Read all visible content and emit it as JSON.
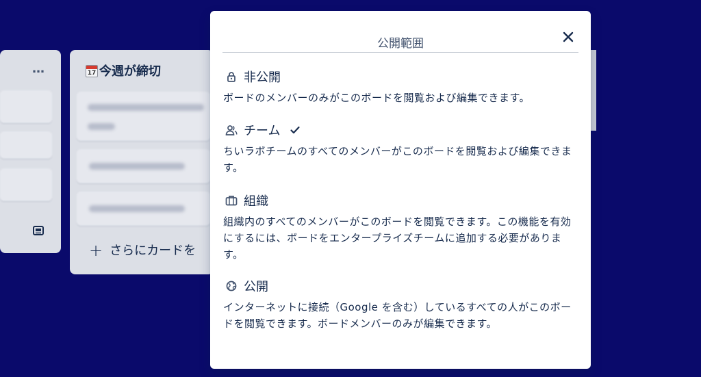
{
  "board": {
    "more_label": "…",
    "list_title": "今週が締切",
    "calendar_day": "17",
    "add_card_label": "さらにカードを"
  },
  "popover": {
    "title": "公開範囲",
    "close_label": "Close",
    "options": [
      {
        "name": "非公開",
        "icon": "lock-icon",
        "selected": false,
        "description": "ボードのメンバーのみがこのボードを閲覧および編集できます。"
      },
      {
        "name": "チーム",
        "icon": "team-icon",
        "selected": true,
        "description": "ちいラボチームのすべてのメンバーがこのボードを閲覧および編集できます。"
      },
      {
        "name": "組織",
        "icon": "briefcase-icon",
        "selected": false,
        "description": "組織内のすべてのメンバーがこのボードを閲覧できます。この機能を有効にするには、ボードをエンタープライズチームに追加する必要があります。"
      },
      {
        "name": "公開",
        "icon": "globe-icon",
        "selected": false,
        "description": "インターネットに接続（Google を含む）しているすべての人がこのボードを閲覧できます。ボードメンバーのみが編集できます。"
      }
    ]
  },
  "colors": {
    "background": "#0a0a6b",
    "popover": "#ffffff",
    "text": "#172b4d"
  }
}
